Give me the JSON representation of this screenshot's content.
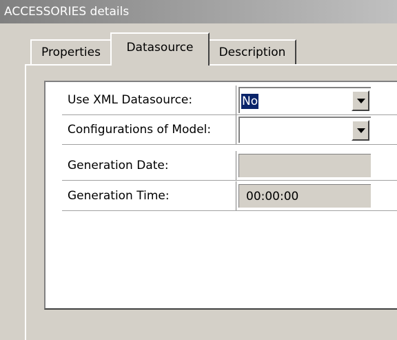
{
  "window": {
    "title": "ACCESSORIES details"
  },
  "tabs": [
    {
      "label": "Properties",
      "active": false
    },
    {
      "label": "Datasource",
      "active": true
    },
    {
      "label": "Description",
      "active": false
    }
  ],
  "fields": [
    {
      "label": "Use XML Datasource:",
      "type": "dropdown",
      "value": "No",
      "selected": true
    },
    {
      "label": "Configurations of Model:",
      "type": "dropdown",
      "value": ""
    },
    {
      "label": "Generation Date:",
      "type": "readonly",
      "value": ""
    },
    {
      "label": "Generation Time:",
      "type": "readonly",
      "value": "00:00:00"
    }
  ]
}
